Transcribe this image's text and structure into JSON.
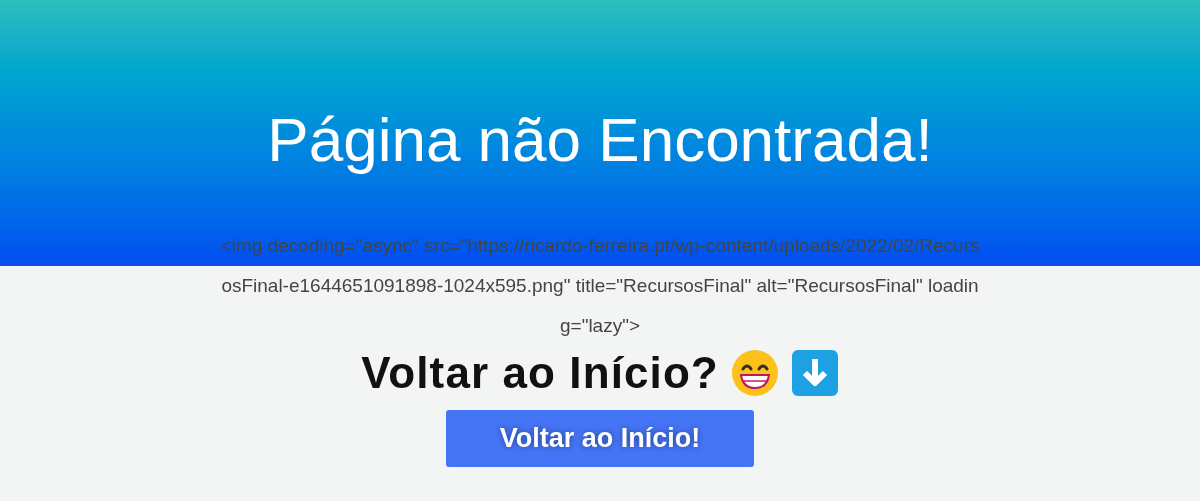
{
  "header": {
    "title": "Página não Encontrada!"
  },
  "raw_markup": "<img decoding=\"async\" src=\"https://ricardo-ferreira.pt/wp-content/uploads/2022/02/RecursosFinal-e1644651091898-1024x595.png\" title=\"RecursosFinal\" alt=\"RecursosFinal\" loading=\"lazy\">",
  "prompt": {
    "text": "Voltar ao Início?"
  },
  "button": {
    "label": "Voltar ao Início!"
  }
}
